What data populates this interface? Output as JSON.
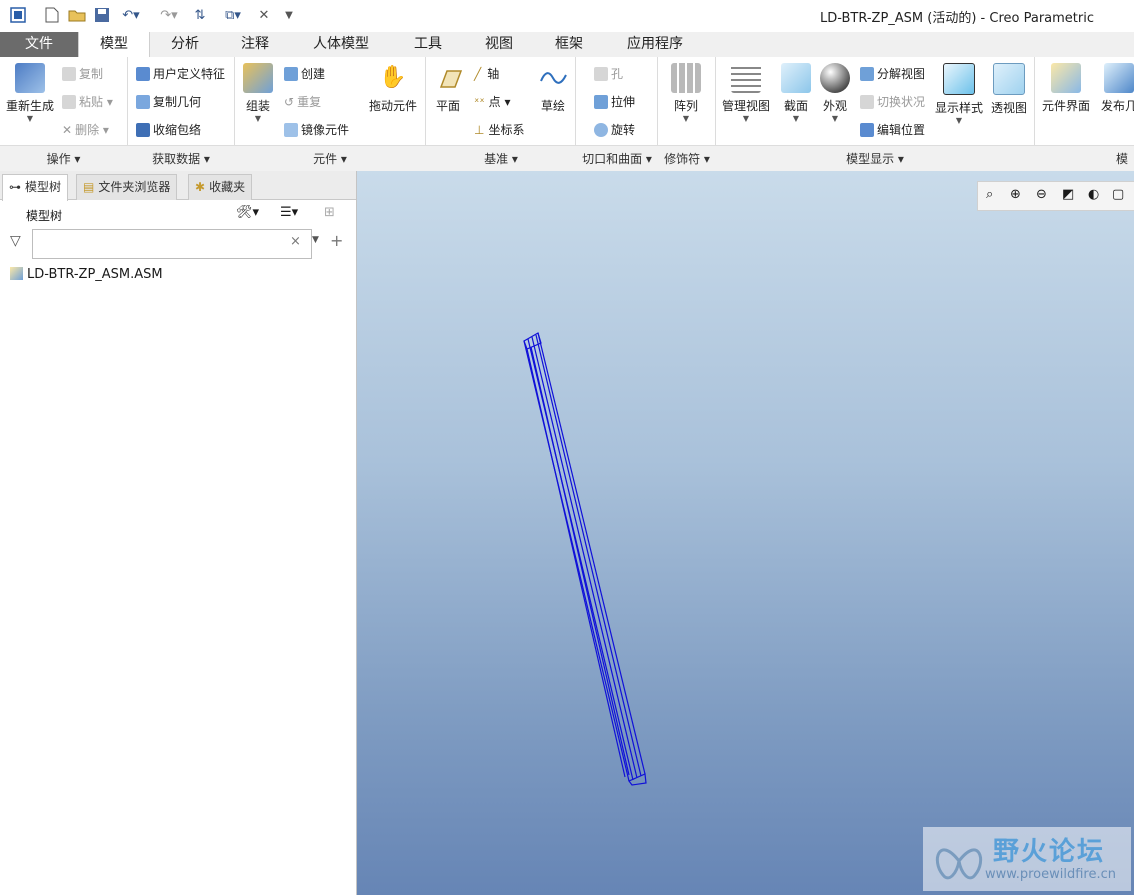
{
  "window": {
    "title": "LD-BTR-ZP_ASM (活动的) - Creo Parametric"
  },
  "tabs": [
    "文件",
    "模型",
    "分析",
    "注释",
    "人体模型",
    "工具",
    "视图",
    "框架",
    "应用程序"
  ],
  "active_tab": "模型",
  "ribbon": {
    "regenerate": "重新生成",
    "copy": "复制",
    "paste": "粘贴",
    "delete": "删除",
    "udf": "用户定义特征",
    "copy_geom": "复制几何",
    "shrinkwrap": "收缩包络",
    "assemble": "组装",
    "create": "创建",
    "repeat": "重复",
    "mirror_comp": "镜像元件",
    "drag_comp": "拖动元件",
    "plane": "平面",
    "axis": "轴",
    "point": "点",
    "csys": "坐标系",
    "sketch": "草绘",
    "hole": "孔",
    "extrude": "拉伸",
    "revolve": "旋转",
    "pattern": "阵列",
    "manage_views": "管理视图",
    "section": "截面",
    "appearance": "外观",
    "explode_view": "分解视图",
    "toggle_status": "切换状况",
    "edit_position": "编辑位置",
    "display_style": "显示样式",
    "perspective": "透视图",
    "comp_interface": "元件界面",
    "publish_geom": "发布几"
  },
  "groups": [
    "操作",
    "获取数据",
    "元件",
    "基准",
    "切口和曲面",
    "修饰符",
    "模型显示",
    "模"
  ],
  "panel": {
    "tabs": [
      "模型树",
      "文件夹浏览器",
      "收藏夹"
    ],
    "header": "模型树",
    "filter_placeholder": "",
    "tree_items": [
      "LD-BTR-ZP_ASM.ASM"
    ]
  },
  "watermark": {
    "title": "野火论坛",
    "url": "www.proewildfire.cn"
  },
  "colors": {
    "model_wire": "#1010d8",
    "file_tab": "#6b6b6b",
    "accent": "#34568a"
  }
}
